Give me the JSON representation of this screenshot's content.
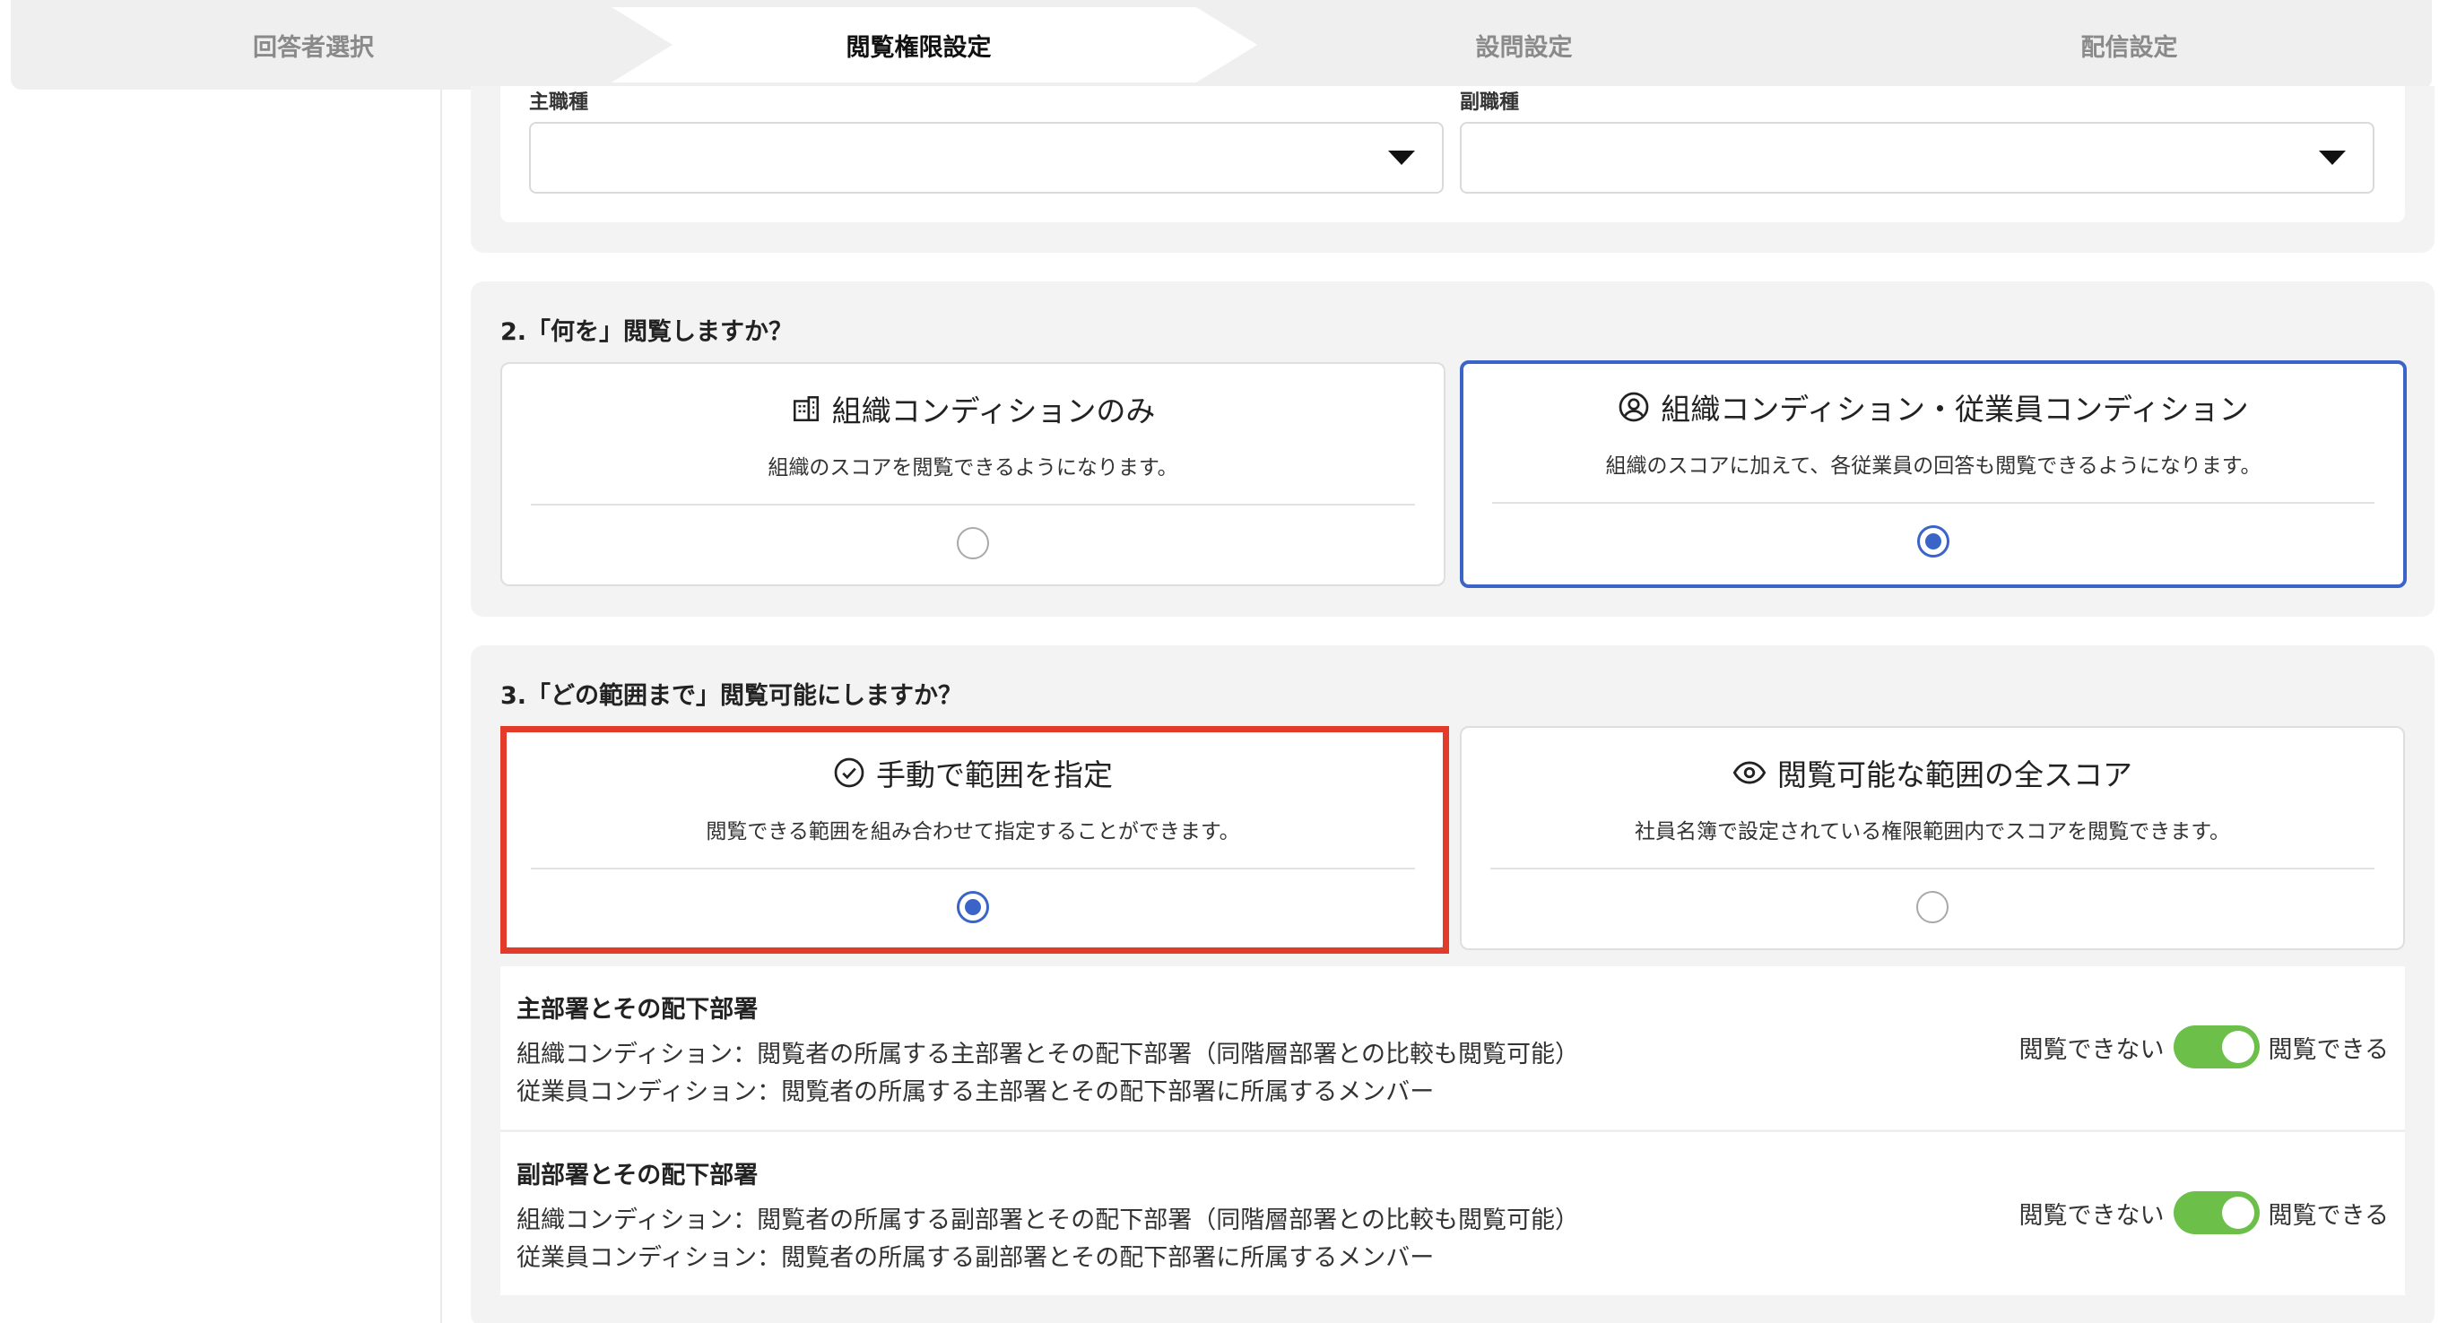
{
  "stepper": {
    "steps": [
      {
        "label": "回答者選択",
        "active": false
      },
      {
        "label": "閲覧権限設定",
        "active": true
      },
      {
        "label": "設問設定",
        "active": false
      },
      {
        "label": "配信設定",
        "active": false
      }
    ]
  },
  "section1": {
    "primary_job_label": "主職種",
    "secondary_job_label": "副職種",
    "primary_job_value": "",
    "secondary_job_value": ""
  },
  "section2": {
    "title": "2.「何を」閲覧しますか？",
    "options": [
      {
        "label": "組織コンディションのみ",
        "description": "組織のスコアを閲覧できるようになります。",
        "icon": "building-icon",
        "selected": false
      },
      {
        "label": "組織コンディション・従業員コンディション",
        "description": "組織のスコアに加えて、各従業員の回答も閲覧できるようになります。",
        "icon": "user-circle-icon",
        "selected": true
      }
    ]
  },
  "section3": {
    "title": "3.「どの範囲まで」閲覧可能にしますか？",
    "options": [
      {
        "label": "手動で範囲を指定",
        "description": "閲覧できる範囲を組み合わせて指定することができます。",
        "icon": "check-circle-icon",
        "selected": true
      },
      {
        "label": "閲覧可能な範囲の全スコア",
        "description": "社員名簿で設定されている権限範囲内でスコアを閲覧できます。",
        "icon": "eye-icon",
        "selected": false
      }
    ],
    "rows": [
      {
        "title": "主部署とその配下部署",
        "line1": "組織コンディション：閲覧者の所属する主部署とその配下部署（同階層部署との比較も閲覧可能）",
        "line2": "従業員コンディション：閲覧者の所属する主部署とその配下部署に所属するメンバー",
        "off_label": "閲覧できない",
        "on_label": "閲覧できる",
        "enabled": true
      },
      {
        "title": "副部署とその配下部署",
        "line1": "組織コンディション：閲覧者の所属する副部署とその配下部署（同階層部署との比較も閲覧可能）",
        "line2": "従業員コンディション：閲覧者の所属する副部署とその配下部署に所属するメンバー",
        "off_label": "閲覧できない",
        "on_label": "閲覧できる",
        "enabled": true
      }
    ]
  },
  "colors": {
    "accent": "#3a64c8",
    "highlight": "#e33a2a",
    "toggle_on": "#6cc04a"
  }
}
